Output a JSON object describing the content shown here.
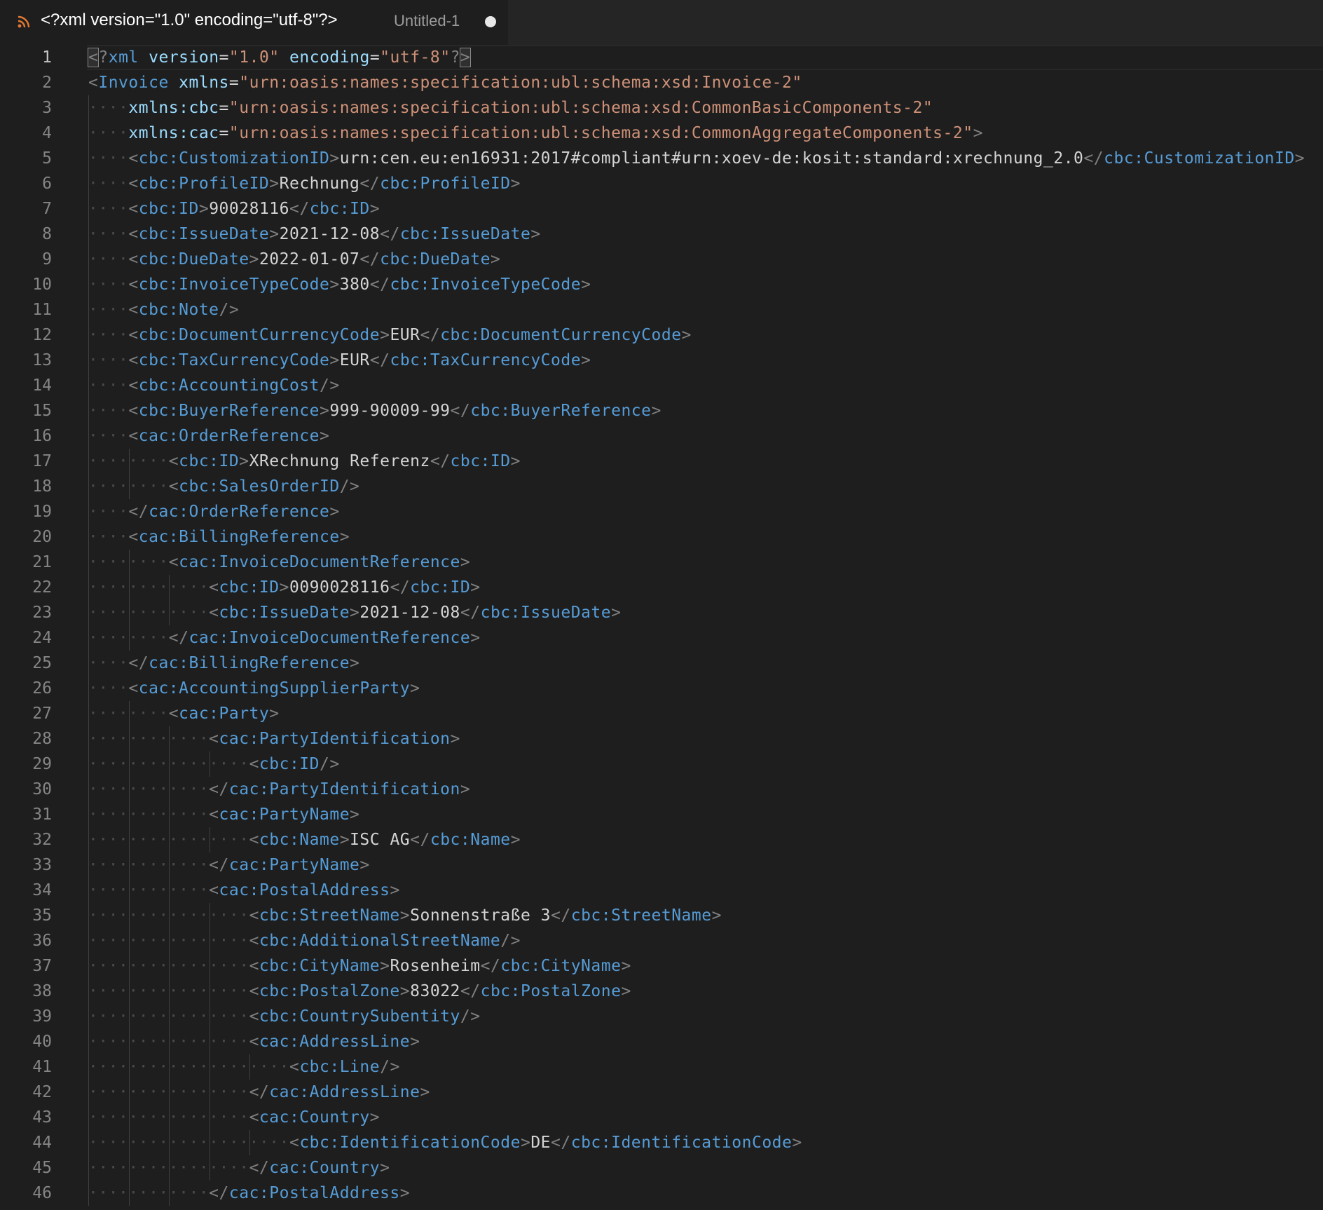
{
  "tab": {
    "title": "<?xml version=\"1.0\" encoding=\"utf-8\"?>",
    "description": "Untitled-1",
    "icon": "rss-icon",
    "dirty": true
  },
  "editor": {
    "current_line": 1,
    "indent_unit": 4,
    "lines": [
      {
        "n": "1",
        "i": 0,
        "tokens": [
          [
            "p",
            "<"
          ],
          [
            "p",
            "?"
          ],
          [
            "t",
            "xml"
          ],
          [
            "x",
            " "
          ],
          [
            "a",
            "version"
          ],
          [
            "x",
            "="
          ],
          [
            "v",
            "\"1.0\""
          ],
          [
            "x",
            " "
          ],
          [
            "a",
            "encoding"
          ],
          [
            "x",
            "="
          ],
          [
            "v",
            "\"utf-8\""
          ],
          [
            "p",
            "?"
          ],
          [
            "p",
            ">"
          ]
        ]
      },
      {
        "n": "2",
        "i": 0,
        "tokens": [
          [
            "p",
            "<"
          ],
          [
            "t",
            "Invoice"
          ],
          [
            "x",
            " "
          ],
          [
            "a",
            "xmlns"
          ],
          [
            "x",
            "="
          ],
          [
            "v",
            "\"urn:oasis:names:specification:ubl:schema:xsd:Invoice-2\""
          ]
        ]
      },
      {
        "n": "3",
        "i": 1,
        "tokens": [
          [
            "a",
            "xmlns:cbc"
          ],
          [
            "x",
            "="
          ],
          [
            "v",
            "\"urn:oasis:names:specification:ubl:schema:xsd:CommonBasicComponents-2\""
          ]
        ]
      },
      {
        "n": "4",
        "i": 1,
        "tokens": [
          [
            "a",
            "xmlns:cac"
          ],
          [
            "x",
            "="
          ],
          [
            "v",
            "\"urn:oasis:names:specification:ubl:schema:xsd:CommonAggregateComponents-2\""
          ],
          [
            "p",
            ">"
          ]
        ]
      },
      {
        "n": "5",
        "i": 1,
        "tokens": [
          [
            "p",
            "<"
          ],
          [
            "t",
            "cbc:CustomizationID"
          ],
          [
            "p",
            ">"
          ],
          [
            "x",
            "urn:cen.eu:en16931:2017#compliant#urn:xoev-de:kosit:standard:xrechnung_2.0"
          ],
          [
            "p",
            "</"
          ],
          [
            "t",
            "cbc:CustomizationID"
          ],
          [
            "p",
            ">"
          ]
        ]
      },
      {
        "n": "6",
        "i": 1,
        "tokens": [
          [
            "p",
            "<"
          ],
          [
            "t",
            "cbc:ProfileID"
          ],
          [
            "p",
            ">"
          ],
          [
            "x",
            "Rechnung"
          ],
          [
            "p",
            "</"
          ],
          [
            "t",
            "cbc:ProfileID"
          ],
          [
            "p",
            ">"
          ]
        ]
      },
      {
        "n": "7",
        "i": 1,
        "tokens": [
          [
            "p",
            "<"
          ],
          [
            "t",
            "cbc:ID"
          ],
          [
            "p",
            ">"
          ],
          [
            "x",
            "90028116"
          ],
          [
            "p",
            "</"
          ],
          [
            "t",
            "cbc:ID"
          ],
          [
            "p",
            ">"
          ]
        ]
      },
      {
        "n": "8",
        "i": 1,
        "tokens": [
          [
            "p",
            "<"
          ],
          [
            "t",
            "cbc:IssueDate"
          ],
          [
            "p",
            ">"
          ],
          [
            "x",
            "2021-12-08"
          ],
          [
            "p",
            "</"
          ],
          [
            "t",
            "cbc:IssueDate"
          ],
          [
            "p",
            ">"
          ]
        ]
      },
      {
        "n": "9",
        "i": 1,
        "tokens": [
          [
            "p",
            "<"
          ],
          [
            "t",
            "cbc:DueDate"
          ],
          [
            "p",
            ">"
          ],
          [
            "x",
            "2022-01-07"
          ],
          [
            "p",
            "</"
          ],
          [
            "t",
            "cbc:DueDate"
          ],
          [
            "p",
            ">"
          ]
        ]
      },
      {
        "n": "10",
        "i": 1,
        "tokens": [
          [
            "p",
            "<"
          ],
          [
            "t",
            "cbc:InvoiceTypeCode"
          ],
          [
            "p",
            ">"
          ],
          [
            "x",
            "380"
          ],
          [
            "p",
            "</"
          ],
          [
            "t",
            "cbc:InvoiceTypeCode"
          ],
          [
            "p",
            ">"
          ]
        ]
      },
      {
        "n": "11",
        "i": 1,
        "tokens": [
          [
            "p",
            "<"
          ],
          [
            "t",
            "cbc:Note"
          ],
          [
            "p",
            "/>"
          ]
        ]
      },
      {
        "n": "12",
        "i": 1,
        "tokens": [
          [
            "p",
            "<"
          ],
          [
            "t",
            "cbc:DocumentCurrencyCode"
          ],
          [
            "p",
            ">"
          ],
          [
            "x",
            "EUR"
          ],
          [
            "p",
            "</"
          ],
          [
            "t",
            "cbc:DocumentCurrencyCode"
          ],
          [
            "p",
            ">"
          ]
        ]
      },
      {
        "n": "13",
        "i": 1,
        "tokens": [
          [
            "p",
            "<"
          ],
          [
            "t",
            "cbc:TaxCurrencyCode"
          ],
          [
            "p",
            ">"
          ],
          [
            "x",
            "EUR"
          ],
          [
            "p",
            "</"
          ],
          [
            "t",
            "cbc:TaxCurrencyCode"
          ],
          [
            "p",
            ">"
          ]
        ]
      },
      {
        "n": "14",
        "i": 1,
        "tokens": [
          [
            "p",
            "<"
          ],
          [
            "t",
            "cbc:AccountingCost"
          ],
          [
            "p",
            "/>"
          ]
        ]
      },
      {
        "n": "15",
        "i": 1,
        "tokens": [
          [
            "p",
            "<"
          ],
          [
            "t",
            "cbc:BuyerReference"
          ],
          [
            "p",
            ">"
          ],
          [
            "x",
            "999-90009-99"
          ],
          [
            "p",
            "</"
          ],
          [
            "t",
            "cbc:BuyerReference"
          ],
          [
            "p",
            ">"
          ]
        ]
      },
      {
        "n": "16",
        "i": 1,
        "tokens": [
          [
            "p",
            "<"
          ],
          [
            "t",
            "cac:OrderReference"
          ],
          [
            "p",
            ">"
          ]
        ]
      },
      {
        "n": "17",
        "i": 2,
        "tokens": [
          [
            "p",
            "<"
          ],
          [
            "t",
            "cbc:ID"
          ],
          [
            "p",
            ">"
          ],
          [
            "x",
            "XRechnung Referenz"
          ],
          [
            "p",
            "</"
          ],
          [
            "t",
            "cbc:ID"
          ],
          [
            "p",
            ">"
          ]
        ]
      },
      {
        "n": "18",
        "i": 2,
        "tokens": [
          [
            "p",
            "<"
          ],
          [
            "t",
            "cbc:SalesOrderID"
          ],
          [
            "p",
            "/>"
          ]
        ]
      },
      {
        "n": "19",
        "i": 1,
        "tokens": [
          [
            "p",
            "</"
          ],
          [
            "t",
            "cac:OrderReference"
          ],
          [
            "p",
            ">"
          ]
        ]
      },
      {
        "n": "20",
        "i": 1,
        "tokens": [
          [
            "p",
            "<"
          ],
          [
            "t",
            "cac:BillingReference"
          ],
          [
            "p",
            ">"
          ]
        ]
      },
      {
        "n": "21",
        "i": 2,
        "tokens": [
          [
            "p",
            "<"
          ],
          [
            "t",
            "cac:InvoiceDocumentReference"
          ],
          [
            "p",
            ">"
          ]
        ]
      },
      {
        "n": "22",
        "i": 3,
        "tokens": [
          [
            "p",
            "<"
          ],
          [
            "t",
            "cbc:ID"
          ],
          [
            "p",
            ">"
          ],
          [
            "x",
            "0090028116"
          ],
          [
            "p",
            "</"
          ],
          [
            "t",
            "cbc:ID"
          ],
          [
            "p",
            ">"
          ]
        ]
      },
      {
        "n": "23",
        "i": 3,
        "tokens": [
          [
            "p",
            "<"
          ],
          [
            "t",
            "cbc:IssueDate"
          ],
          [
            "p",
            ">"
          ],
          [
            "x",
            "2021-12-08"
          ],
          [
            "p",
            "</"
          ],
          [
            "t",
            "cbc:IssueDate"
          ],
          [
            "p",
            ">"
          ]
        ]
      },
      {
        "n": "24",
        "i": 2,
        "tokens": [
          [
            "p",
            "</"
          ],
          [
            "t",
            "cac:InvoiceDocumentReference"
          ],
          [
            "p",
            ">"
          ]
        ]
      },
      {
        "n": "25",
        "i": 1,
        "tokens": [
          [
            "p",
            "</"
          ],
          [
            "t",
            "cac:BillingReference"
          ],
          [
            "p",
            ">"
          ]
        ]
      },
      {
        "n": "26",
        "i": 1,
        "tokens": [
          [
            "p",
            "<"
          ],
          [
            "t",
            "cac:AccountingSupplierParty"
          ],
          [
            "p",
            ">"
          ]
        ]
      },
      {
        "n": "27",
        "i": 2,
        "tokens": [
          [
            "p",
            "<"
          ],
          [
            "t",
            "cac:Party"
          ],
          [
            "p",
            ">"
          ]
        ]
      },
      {
        "n": "28",
        "i": 3,
        "tokens": [
          [
            "p",
            "<"
          ],
          [
            "t",
            "cac:PartyIdentification"
          ],
          [
            "p",
            ">"
          ]
        ]
      },
      {
        "n": "29",
        "i": 4,
        "tokens": [
          [
            "p",
            "<"
          ],
          [
            "t",
            "cbc:ID"
          ],
          [
            "p",
            "/>"
          ]
        ]
      },
      {
        "n": "30",
        "i": 3,
        "tokens": [
          [
            "p",
            "</"
          ],
          [
            "t",
            "cac:PartyIdentification"
          ],
          [
            "p",
            ">"
          ]
        ]
      },
      {
        "n": "31",
        "i": 3,
        "tokens": [
          [
            "p",
            "<"
          ],
          [
            "t",
            "cac:PartyName"
          ],
          [
            "p",
            ">"
          ]
        ]
      },
      {
        "n": "32",
        "i": 4,
        "tokens": [
          [
            "p",
            "<"
          ],
          [
            "t",
            "cbc:Name"
          ],
          [
            "p",
            ">"
          ],
          [
            "x",
            "ISC AG"
          ],
          [
            "p",
            "</"
          ],
          [
            "t",
            "cbc:Name"
          ],
          [
            "p",
            ">"
          ]
        ]
      },
      {
        "n": "33",
        "i": 3,
        "tokens": [
          [
            "p",
            "</"
          ],
          [
            "t",
            "cac:PartyName"
          ],
          [
            "p",
            ">"
          ]
        ]
      },
      {
        "n": "34",
        "i": 3,
        "tokens": [
          [
            "p",
            "<"
          ],
          [
            "t",
            "cac:PostalAddress"
          ],
          [
            "p",
            ">"
          ]
        ]
      },
      {
        "n": "35",
        "i": 4,
        "tokens": [
          [
            "p",
            "<"
          ],
          [
            "t",
            "cbc:StreetName"
          ],
          [
            "p",
            ">"
          ],
          [
            "x",
            "Sonnenstraße 3"
          ],
          [
            "p",
            "</"
          ],
          [
            "t",
            "cbc:StreetName"
          ],
          [
            "p",
            ">"
          ]
        ]
      },
      {
        "n": "36",
        "i": 4,
        "tokens": [
          [
            "p",
            "<"
          ],
          [
            "t",
            "cbc:AdditionalStreetName"
          ],
          [
            "p",
            "/>"
          ]
        ]
      },
      {
        "n": "37",
        "i": 4,
        "tokens": [
          [
            "p",
            "<"
          ],
          [
            "t",
            "cbc:CityName"
          ],
          [
            "p",
            ">"
          ],
          [
            "x",
            "Rosenheim"
          ],
          [
            "p",
            "</"
          ],
          [
            "t",
            "cbc:CityName"
          ],
          [
            "p",
            ">"
          ]
        ]
      },
      {
        "n": "38",
        "i": 4,
        "tokens": [
          [
            "p",
            "<"
          ],
          [
            "t",
            "cbc:PostalZone"
          ],
          [
            "p",
            ">"
          ],
          [
            "x",
            "83022"
          ],
          [
            "p",
            "</"
          ],
          [
            "t",
            "cbc:PostalZone"
          ],
          [
            "p",
            ">"
          ]
        ]
      },
      {
        "n": "39",
        "i": 4,
        "tokens": [
          [
            "p",
            "<"
          ],
          [
            "t",
            "cbc:CountrySubentity"
          ],
          [
            "p",
            "/>"
          ]
        ]
      },
      {
        "n": "40",
        "i": 4,
        "tokens": [
          [
            "p",
            "<"
          ],
          [
            "t",
            "cac:AddressLine"
          ],
          [
            "p",
            ">"
          ]
        ]
      },
      {
        "n": "41",
        "i": 5,
        "tokens": [
          [
            "p",
            "<"
          ],
          [
            "t",
            "cbc:Line"
          ],
          [
            "p",
            "/>"
          ]
        ]
      },
      {
        "n": "42",
        "i": 4,
        "tokens": [
          [
            "p",
            "</"
          ],
          [
            "t",
            "cac:AddressLine"
          ],
          [
            "p",
            ">"
          ]
        ]
      },
      {
        "n": "43",
        "i": 4,
        "tokens": [
          [
            "p",
            "<"
          ],
          [
            "t",
            "cac:Country"
          ],
          [
            "p",
            ">"
          ]
        ]
      },
      {
        "n": "44",
        "i": 5,
        "tokens": [
          [
            "p",
            "<"
          ],
          [
            "t",
            "cbc:IdentificationCode"
          ],
          [
            "p",
            ">"
          ],
          [
            "x",
            "DE"
          ],
          [
            "p",
            "</"
          ],
          [
            "t",
            "cbc:IdentificationCode"
          ],
          [
            "p",
            ">"
          ]
        ]
      },
      {
        "n": "45",
        "i": 4,
        "tokens": [
          [
            "p",
            "</"
          ],
          [
            "t",
            "cac:Country"
          ],
          [
            "p",
            ">"
          ]
        ]
      },
      {
        "n": "46",
        "i": 3,
        "tokens": [
          [
            "p",
            "</"
          ],
          [
            "t",
            "cac:PostalAddress"
          ],
          [
            "p",
            ">"
          ]
        ]
      }
    ]
  }
}
